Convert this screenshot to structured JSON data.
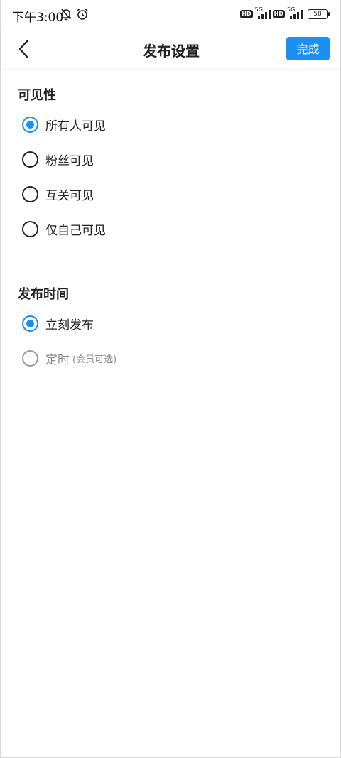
{
  "status_bar": {
    "time": "下午3:00",
    "left_icons": [
      "bell-off-icon",
      "alarm-icon"
    ],
    "hd_label": "HD",
    "network_label": "5G",
    "battery": "58"
  },
  "nav": {
    "title": "发布设置",
    "done_label": "完成",
    "accent_color": "#1a90f2"
  },
  "visibility": {
    "title": "可见性",
    "options": [
      {
        "label": "所有人可见",
        "selected": true
      },
      {
        "label": "粉丝可见",
        "selected": false
      },
      {
        "label": "互关可见",
        "selected": false
      },
      {
        "label": "仅自己可见",
        "selected": false
      }
    ]
  },
  "publish_time": {
    "title": "发布时间",
    "options": [
      {
        "label": "立刻发布",
        "selected": true,
        "disabled": false
      },
      {
        "label": "定时",
        "note": "(会员可选)",
        "selected": false,
        "disabled": true
      }
    ]
  }
}
